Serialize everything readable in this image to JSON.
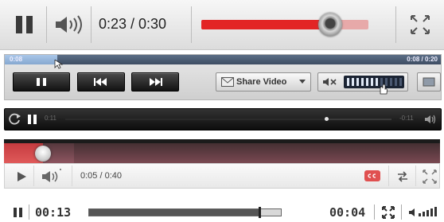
{
  "player1": {
    "time_label": "0:23 / 0:30",
    "progress": 0.77,
    "accent": "#e32424",
    "icons": [
      "pause-icon",
      "volume-icon",
      "fullscreen-icon"
    ]
  },
  "player2": {
    "elapsed_label": "0:08",
    "time_right_label": "0:08 / 0:20",
    "buffered": 0.12,
    "share_label": "Share Video",
    "volume_level": 0.55,
    "icons": [
      "pause-icon",
      "rewind-icon",
      "fast-forward-icon",
      "mute-icon",
      "chevron-down-icon"
    ]
  },
  "player3": {
    "elapsed_label": "0:11",
    "remaining_label": "-0:11",
    "progress": 0.8,
    "icons": [
      "refresh-icon",
      "pause-icon",
      "volume-icon"
    ]
  },
  "player4": {
    "time_label": "0:05 / 0:40",
    "progress": 0.09,
    "buffered": 0.16,
    "accent": "#e05050",
    "icons": [
      "play-icon",
      "volume-icon",
      "captions-icon",
      "share-icon",
      "fullscreen-icon"
    ]
  },
  "player5": {
    "elapsed_label": "00:13",
    "remaining_label": "00:04",
    "progress": 0.89,
    "icons": [
      "pause-icon",
      "fullscreen-icon",
      "volume-icon"
    ]
  }
}
